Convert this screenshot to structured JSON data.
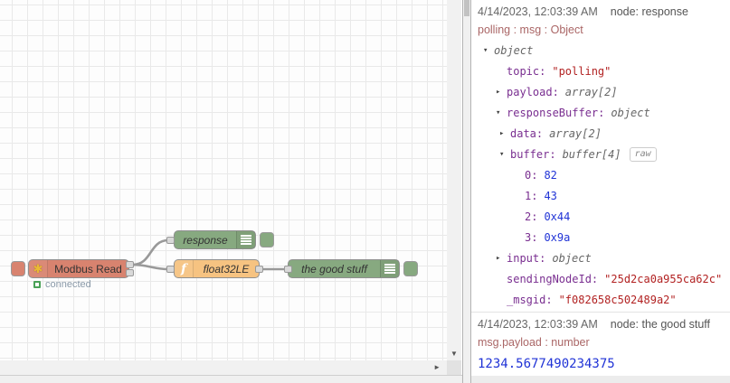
{
  "colors": {
    "modbus_node": "#d8836f",
    "debug_node": "#87a980",
    "function_node": "#f6c381",
    "wire": "#999999",
    "key_purple": "#792e90",
    "string_red": "#b22222",
    "number_blue": "#2033d6",
    "topic_rust": "#aa6666",
    "status_green": "#4aa157"
  },
  "canvas": {
    "nodes": {
      "modbus_read": {
        "label": "Modbus Read",
        "status": "connected",
        "icon": "modbus-flower-icon"
      },
      "response": {
        "label": "response",
        "icon": "debug-lines-icon"
      },
      "float32le": {
        "label": "float32LE",
        "icon": "function-f-icon"
      },
      "the_good_stuff": {
        "label": "the good stuff",
        "icon": "debug-lines-icon"
      }
    },
    "scrollbars": {
      "down_arrow": "▼",
      "right_arrow": "►"
    }
  },
  "debug": {
    "message1": {
      "timestamp": "4/14/2023, 12:03:39 AM",
      "node": "node: response",
      "topic": "polling : msg : Object",
      "rows": [
        {
          "arrow": "▾",
          "key": "",
          "value": "object"
        },
        {
          "arrow": "",
          "key": "topic:",
          "value": "\"polling\""
        },
        {
          "arrow": "▸",
          "key": "payload:",
          "value": "array[2]"
        },
        {
          "arrow": "▾",
          "key": "responseBuffer:",
          "value": "object"
        },
        {
          "arrow": "▸",
          "key": "data:",
          "value": "array[2]"
        },
        {
          "arrow": "▾",
          "key": "buffer:",
          "value": "buffer[4]",
          "badge": "raw"
        },
        {
          "arrow": "",
          "key": "0:",
          "value": "82"
        },
        {
          "arrow": "",
          "key": "1:",
          "value": "43"
        },
        {
          "arrow": "",
          "key": "2:",
          "value": "0x44"
        },
        {
          "arrow": "",
          "key": "3:",
          "value": "0x9a"
        },
        {
          "arrow": "▸",
          "key": "input:",
          "value": "object"
        },
        {
          "arrow": "",
          "key": "sendingNodeId:",
          "value": "\"25d2ca0a955ca62c\""
        },
        {
          "arrow": "",
          "key": "_msgid:",
          "value": "\"f082658c502489a2\""
        }
      ]
    },
    "message2": {
      "timestamp": "4/14/2023, 12:03:39 AM",
      "node": "node: the good stuff",
      "topic": "msg.payload : number",
      "payload": "1234.5677490234375"
    }
  }
}
